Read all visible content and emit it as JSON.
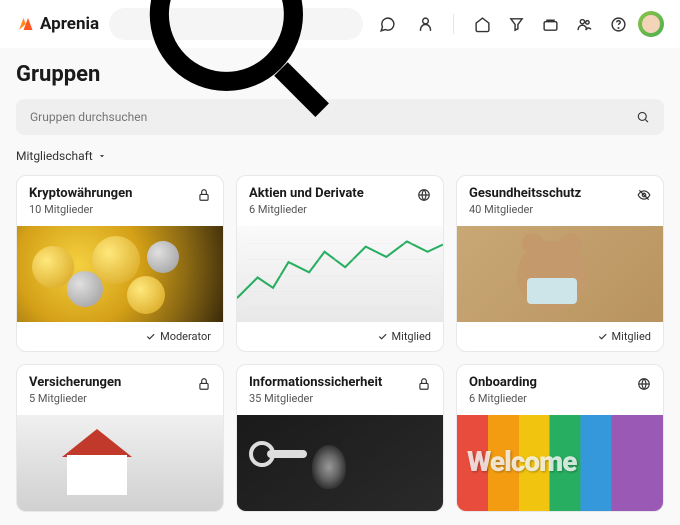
{
  "brand": "Aprenia",
  "page_title": "Gruppen",
  "search_groups_placeholder": "Gruppen durchsuchen",
  "filter_label": "Mitgliedschaft",
  "groups": [
    {
      "title": "Kryptowährungen",
      "members": "10 Mitglieder",
      "visibility": "lock",
      "role": "Moderator"
    },
    {
      "title": "Aktien und Derivate",
      "members": "6 Mitglieder",
      "visibility": "globe",
      "role": "Mitglied"
    },
    {
      "title": "Gesundheitsschutz",
      "members": "40 Mitglieder",
      "visibility": "hidden",
      "role": "Mitglied"
    },
    {
      "title": "Versicherungen",
      "members": "5 Mitglieder",
      "visibility": "lock",
      "role": ""
    },
    {
      "title": "Informationssicherheit",
      "members": "35 Mitglieder",
      "visibility": "lock",
      "role": ""
    },
    {
      "title": "Onboarding",
      "members": "6 Mitglieder",
      "visibility": "globe",
      "role": ""
    }
  ],
  "welcome_text": "Welcome"
}
